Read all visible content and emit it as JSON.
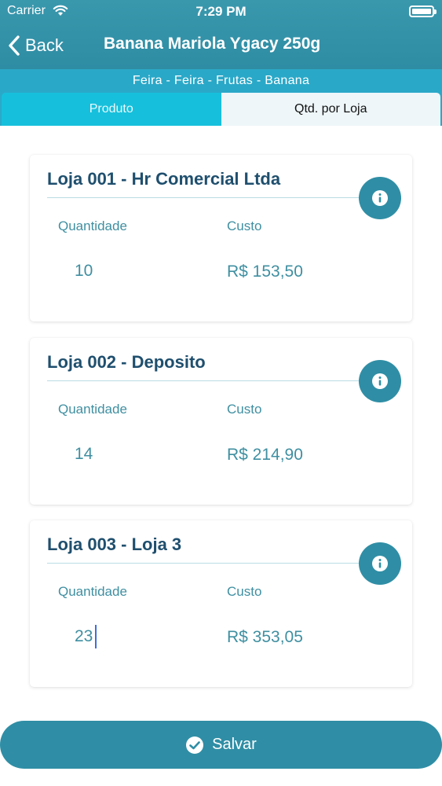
{
  "status": {
    "carrier": "Carrier",
    "time": "7:29 PM"
  },
  "nav": {
    "back_label": "Back",
    "title": "Banana Mariola Ygacy 250g"
  },
  "breadcrumb": "Feira - Feira - Frutas - Banana",
  "tabs": [
    {
      "label": "Produto",
      "active": true
    },
    {
      "label": "Qtd. por Loja",
      "active": false
    }
  ],
  "stores": [
    {
      "name": "Loja 001 - Hr Comercial Ltda",
      "qty_label": "Quantidade",
      "qty": "10",
      "cost_label": "Custo",
      "cost": "R$ 153,50"
    },
    {
      "name": "Loja 002 - Deposito",
      "qty_label": "Quantidade",
      "qty": "14",
      "cost_label": "Custo",
      "cost": "R$ 214,90"
    },
    {
      "name": "Loja 003 - Loja 3",
      "qty_label": "Quantidade",
      "qty": "23",
      "cost_label": "Custo",
      "cost": "R$ 353,05"
    }
  ],
  "save_label": "Salvar",
  "colors": {
    "header": "#2e8ca3",
    "tab_active": "#16c0dc",
    "accent": "#2f8ea5",
    "store_title": "#1f4f6e"
  }
}
